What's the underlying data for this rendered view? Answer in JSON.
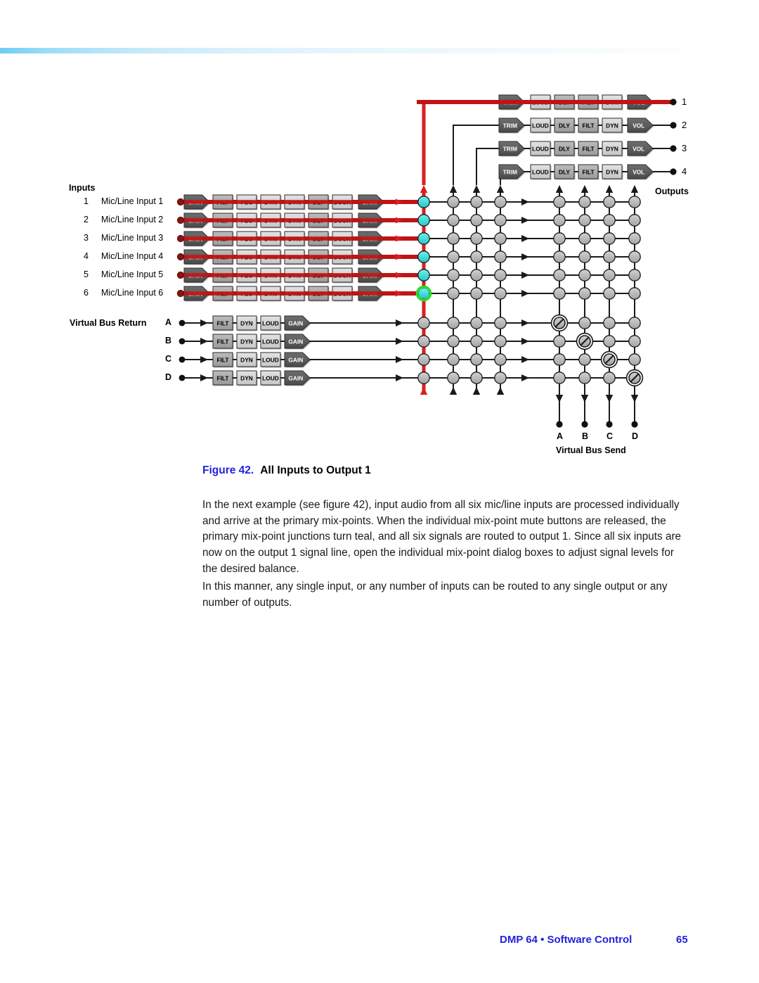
{
  "document": {
    "footer_title": "DMP 64 • Software Control",
    "footer_page": "65"
  },
  "figure": {
    "number": "Figure 42.",
    "title": "All Inputs to Output 1",
    "headings": {
      "inputs": "Inputs",
      "outputs": "Outputs",
      "virtual_bus_return": "Virtual Bus Return",
      "virtual_bus_send": "Virtual Bus Send"
    },
    "input_rows": [
      {
        "num": "1",
        "name": "Mic/Line Input 1"
      },
      {
        "num": "2",
        "name": "Mic/Line Input 2"
      },
      {
        "num": "3",
        "name": "Mic/Line Input 3"
      },
      {
        "num": "4",
        "name": "Mic/Line Input 4"
      },
      {
        "num": "5",
        "name": "Mic/Line Input 5"
      },
      {
        "num": "6",
        "name": "Mic/Line Input 6"
      }
    ],
    "input_chain_blocks": [
      "GAIN",
      "FILT",
      "FBS",
      "DYN",
      "DYN",
      "DLY",
      "DUCK",
      "GAIN"
    ],
    "virtual_bus_return_rows": [
      "A",
      "B",
      "C",
      "D"
    ],
    "virtual_bus_return_chain_blocks": [
      "FILT",
      "DYN",
      "LOUD",
      "GAIN"
    ],
    "output_rows": [
      "1",
      "2",
      "3",
      "4"
    ],
    "output_chain_blocks": [
      "TRIM",
      "LOUD",
      "DLY",
      "FILT",
      "DYN",
      "VOL"
    ],
    "virtual_bus_send_columns": [
      "A",
      "B",
      "C",
      "D"
    ],
    "matrix": {
      "active_column_index": 0,
      "teal_rows": [
        1,
        2,
        3,
        4,
        5
      ],
      "selected_row": 6,
      "muted_diagonal_note": "virtual bus send diagonal mix-points are muted"
    },
    "colors": {
      "signal_red": "#ee2a2a",
      "mixpoint_teal": "#3fd8d8",
      "mixpoint_selected_ring": "#22e022",
      "mixpoint_gray": "#b0b0b0",
      "accent_blue": "#2222dd",
      "band_blue": "#6ecdf5"
    }
  },
  "body": {
    "paragraph_1": "In the next example (see figure 42), input audio from all six mic/line inputs are processed individually and arrive at the primary mix-points. When the individual mix-point mute buttons are released, the primary mix-point junctions turn teal, and all six signals are routed to output 1. Since all six inputs are now on the output 1 signal line, open the individual mix-point dialog boxes to adjust signal levels for the desired balance.",
    "paragraph_2": "In this manner, any single input, or any number of inputs can be routed to any single output or any number of outputs."
  }
}
